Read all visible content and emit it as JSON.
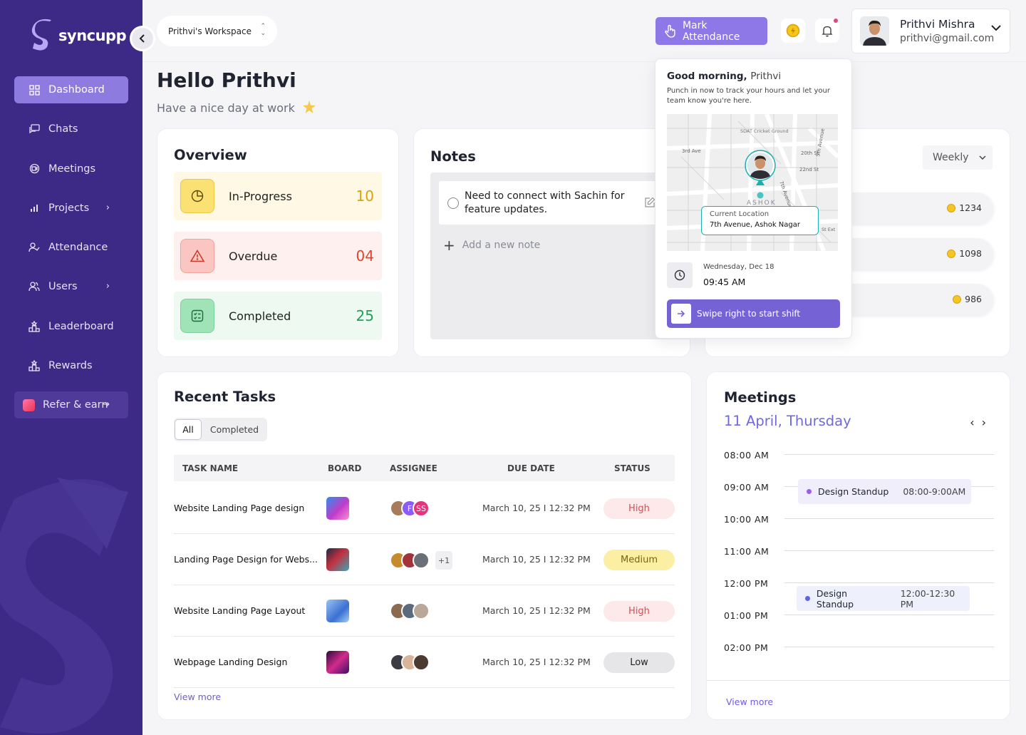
{
  "app": {
    "name": "syncupp"
  },
  "sidebar": {
    "items": [
      {
        "label": "Dashboard",
        "icon": "grid-icon",
        "active": true
      },
      {
        "label": "Chats",
        "icon": "chat-icon"
      },
      {
        "label": "Meetings",
        "icon": "video-icon"
      },
      {
        "label": "Projects",
        "icon": "bar-chart-icon",
        "has_submenu": true
      },
      {
        "label": "Attendance",
        "icon": "user-check-icon"
      },
      {
        "label": "Users",
        "icon": "users-icon",
        "has_submenu": true
      },
      {
        "label": "Leaderboard",
        "icon": "podium-icon"
      },
      {
        "label": "Rewards",
        "icon": "podium-icon"
      },
      {
        "label": "Refer & earn",
        "icon": "gift-icon"
      }
    ]
  },
  "header": {
    "workspace": "Prithvi's Workspace",
    "mark_attendance": "Mark Attendance",
    "user": {
      "name": "Prithvi Mishra",
      "email": "prithvi@gmail.com"
    }
  },
  "greeting": {
    "title": "Hello Prithvi",
    "subtitle": "Have a nice day at work"
  },
  "overview": {
    "title": "Overview",
    "items": [
      {
        "label": "In-Progress",
        "value": "10",
        "color": "#d8a20a"
      },
      {
        "label": "Overdue",
        "value": "04",
        "color": "#e0452c"
      },
      {
        "label": "Completed",
        "value": "25",
        "color": "#22a05a"
      }
    ]
  },
  "notes": {
    "title": "Notes",
    "items": [
      "Need to connect with Sachin for feature updates."
    ],
    "add_placeholder": "Add a new note"
  },
  "leaderboard": {
    "period": "Weekly",
    "rows": [
      {
        "points": "1234"
      },
      {
        "points": "1098"
      },
      {
        "points": "986"
      }
    ]
  },
  "attendance_popup": {
    "greeting": "Good morning,",
    "name": "Prithvi",
    "description": "Punch in now to track your hours and let your team know you're here.",
    "map_labels": [
      "SDAT Cricket Ground",
      "3rd Ave",
      "20th St",
      "22nd St",
      "5th Avenue",
      "7th Avenue",
      "ASHOK",
      "St Ext"
    ],
    "location_label": "Current Location",
    "location_value": "7th Avenue, Ashok Nagar",
    "date": "Wednesday, Dec 18",
    "time": "09:45 AM",
    "swipe_label": "Swipe right to start shift"
  },
  "tasks": {
    "title": "Recent Tasks",
    "tabs": [
      "All",
      "Completed"
    ],
    "columns": [
      "TASK NAME",
      "BOARD",
      "ASSIGNEE",
      "DUE DATE",
      "STATUS"
    ],
    "rows": [
      {
        "name": "Website Landing Page design",
        "due": "March 10, 25 I 12:32 PM",
        "status": "High",
        "assignees": [
          "",
          "F",
          "SS"
        ],
        "extra": ""
      },
      {
        "name": "Landing Page Design for Webs...",
        "due": "March 10, 25 I 12:32 PM",
        "status": "Medium",
        "assignees": [
          "",
          "",
          ""
        ],
        "extra": "+1"
      },
      {
        "name": "Website Landing Page Layout",
        "due": "March 10, 25 I 12:32 PM",
        "status": "High",
        "assignees": [
          "",
          "",
          ""
        ],
        "extra": ""
      },
      {
        "name": "Webpage Landing Design",
        "due": "March 10, 25 I 12:32 PM",
        "status": "Low",
        "assignees": [
          "",
          "",
          ""
        ],
        "extra": ""
      }
    ],
    "view_more": "View more"
  },
  "meetings": {
    "title": "Meetings",
    "date": "11 April, Thursday",
    "slots": [
      "08:00 AM",
      "09:00 AM",
      "10:00 AM",
      "11:00 AM",
      "12:00 PM",
      "01:00 PM",
      "02:00 PM"
    ],
    "events": [
      {
        "title": "Design Standup",
        "time": "08:00-9:00AM",
        "color": "#9b5cf0"
      },
      {
        "title": "Design Standup",
        "time": "12:00-12:30 PM",
        "color": "#5b63e6"
      }
    ],
    "view_more": "View more"
  }
}
